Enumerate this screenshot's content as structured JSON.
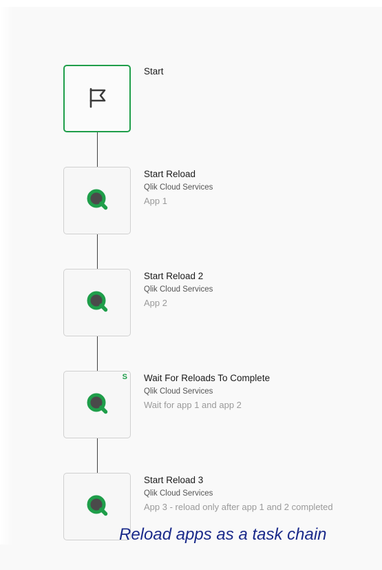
{
  "flow": {
    "nodes": [
      {
        "title": "Start",
        "service": "",
        "description": "",
        "icon": "flag-icon",
        "badge": ""
      },
      {
        "title": "Start Reload",
        "service": "Qlik Cloud Services",
        "description": "App 1",
        "icon": "qlik-icon",
        "badge": ""
      },
      {
        "title": "Start Reload 2",
        "service": "Qlik Cloud Services",
        "description": "App 2",
        "icon": "qlik-icon",
        "badge": ""
      },
      {
        "title": "Wait For Reloads To Complete",
        "service": "Qlik Cloud Services",
        "description": "Wait for app 1 and app 2",
        "icon": "qlik-icon",
        "badge": "S"
      },
      {
        "title": "Start Reload 3",
        "service": "Qlik Cloud Services",
        "description": "App 3 - reload only after app 1 and 2 completed",
        "icon": "qlik-icon",
        "badge": ""
      }
    ]
  },
  "caption": "Reload apps as a task chain",
  "colors": {
    "accent_green": "#1f9e4a",
    "qlik_dark": "#4a4a4a",
    "caption_blue": "#1a2a8a"
  }
}
